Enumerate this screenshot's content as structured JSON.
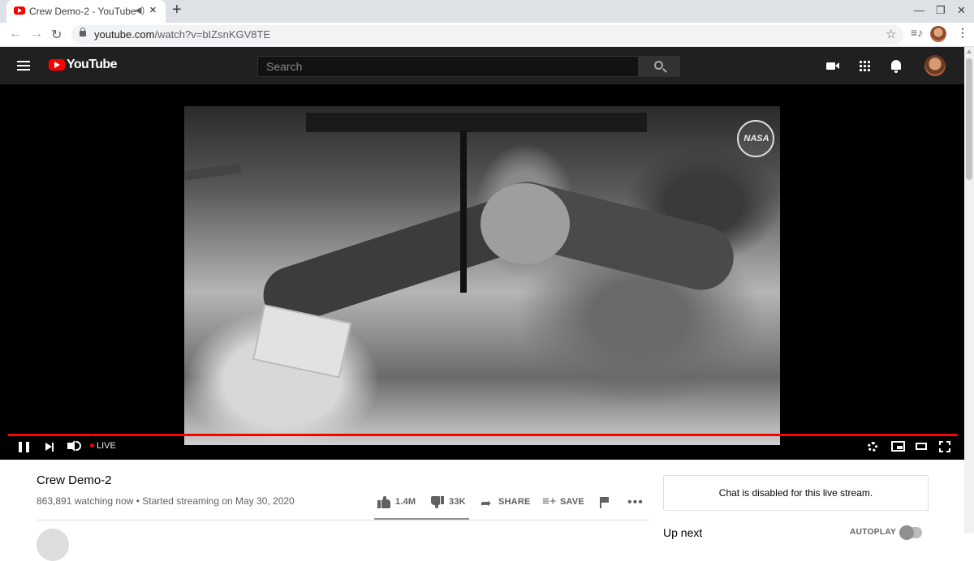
{
  "browser": {
    "tab_title": "Crew Demo-2 - YouTube",
    "tab_audio_icon": "speaker-icon",
    "tab_close": "×",
    "new_tab": "+",
    "url_host": "youtube.com",
    "url_path": "/watch?v=bIZsnKGV8TE",
    "window_controls": [
      "—",
      "❐",
      "✕"
    ]
  },
  "youtube": {
    "logo_text": "YouTube",
    "search_placeholder": "Search"
  },
  "video": {
    "watermark": "NASA",
    "live_label": "LIVE"
  },
  "info": {
    "title": "Crew Demo-2",
    "meta": "863,891 watching now • Started streaming on May 30, 2020",
    "likes": "1.4M",
    "dislikes": "33K",
    "share_label": "SHARE",
    "save_label": "SAVE",
    "more": "•••"
  },
  "sidebar": {
    "chat_disabled": "Chat is disabled for this live stream.",
    "up_next": "Up next",
    "autoplay_label": "AUTOPLAY"
  },
  "colors": {
    "brand_red": "#ff0000",
    "masthead_bg": "#202020",
    "player_bg": "#000000"
  }
}
